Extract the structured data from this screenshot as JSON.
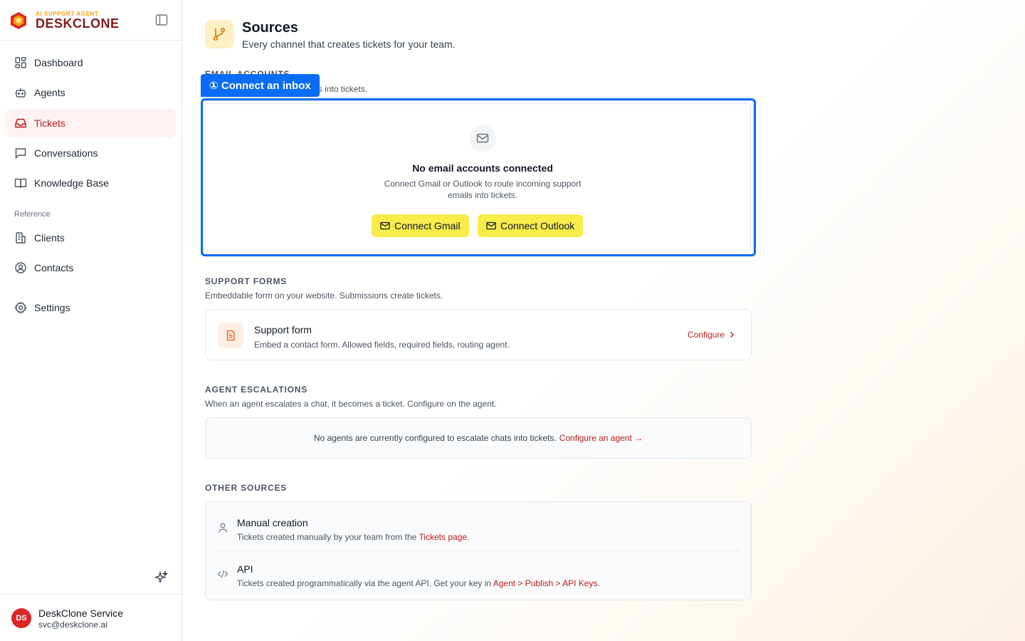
{
  "brand": {
    "tagline": "AI SUPPORT AGENT",
    "name": "DESKCLONE"
  },
  "sidebar": {
    "items": [
      {
        "label": "Dashboard"
      },
      {
        "label": "Agents"
      },
      {
        "label": "Tickets",
        "active": true
      },
      {
        "label": "Conversations"
      },
      {
        "label": "Knowledge Base"
      }
    ],
    "reference_heading": "Reference",
    "reference_items": [
      {
        "label": "Clients"
      },
      {
        "label": "Contacts"
      }
    ],
    "settings_label": "Settings"
  },
  "user": {
    "initials": "DS",
    "name": "DeskClone Service",
    "email": "svc@deskclone.ai"
  },
  "page": {
    "title": "Sources",
    "subtitle": "Every channel that creates tickets for your team."
  },
  "email_accounts": {
    "heading": "EMAIL ACCOUNTS",
    "description": "Route incoming support emails into tickets.",
    "empty_title": "No email accounts connected",
    "empty_desc": "Connect Gmail or Outlook to route incoming support emails into tickets.",
    "gmail_button": "Connect Gmail",
    "outlook_button": "Connect Outlook"
  },
  "callout": {
    "label": "① Connect an inbox"
  },
  "support_forms": {
    "heading": "SUPPORT FORMS",
    "description": "Embeddable form on your website. Submissions create tickets.",
    "card_title": "Support form",
    "card_desc": "Embed a contact form. Allowed fields, required fields, routing agent.",
    "configure_label": "Configure"
  },
  "agent_escalations": {
    "heading": "AGENT ESCALATIONS",
    "description": "When an agent escalates a chat, it becomes a ticket. Configure on the agent.",
    "empty_text": "No agents are currently configured to escalate chats into tickets.",
    "link_label": "Configure an agent →"
  },
  "other_sources": {
    "heading": "OTHER SOURCES",
    "manual_title": "Manual creation",
    "manual_desc_prefix": "Tickets created manually by your team from the",
    "manual_link": "Tickets page",
    "manual_desc_suffix": ".",
    "api_title": "API",
    "api_desc_prefix": "Tickets created programmatically via the agent API. Get your key in",
    "api_link": "Agent > Publish > API Keys",
    "api_desc_suffix": "."
  },
  "colors": {
    "accent": "#b91c1c",
    "highlight": "#0b6cf5",
    "button_yellow": "#f7ec4a"
  }
}
